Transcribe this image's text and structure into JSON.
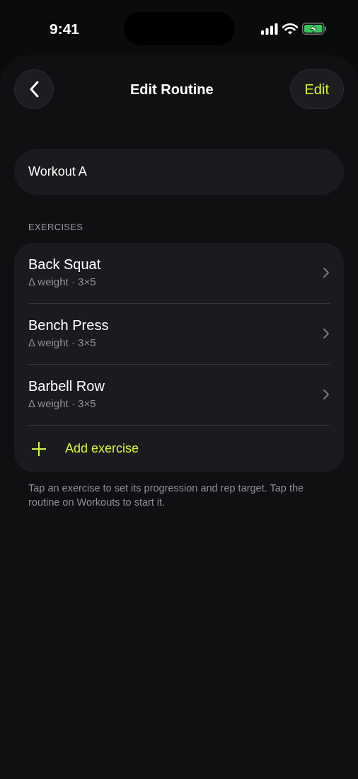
{
  "status_bar": {
    "time": "9:41"
  },
  "header": {
    "title": "Edit Routine",
    "action": "Edit"
  },
  "routine_name": {
    "value": "Workout A"
  },
  "section_label": "EXERCISES",
  "exercises": [
    {
      "name": "Back Squat",
      "detail": "Δ weight · 3×5"
    },
    {
      "name": "Bench Press",
      "detail": "Δ weight · 3×5"
    },
    {
      "name": "Barbell Row",
      "detail": "Δ weight · 3×5"
    }
  ],
  "add_button": {
    "label": "Add exercise"
  },
  "footnote": "Tap an exercise to set its progression and rep target. Tap the routine on Workouts to start it."
}
